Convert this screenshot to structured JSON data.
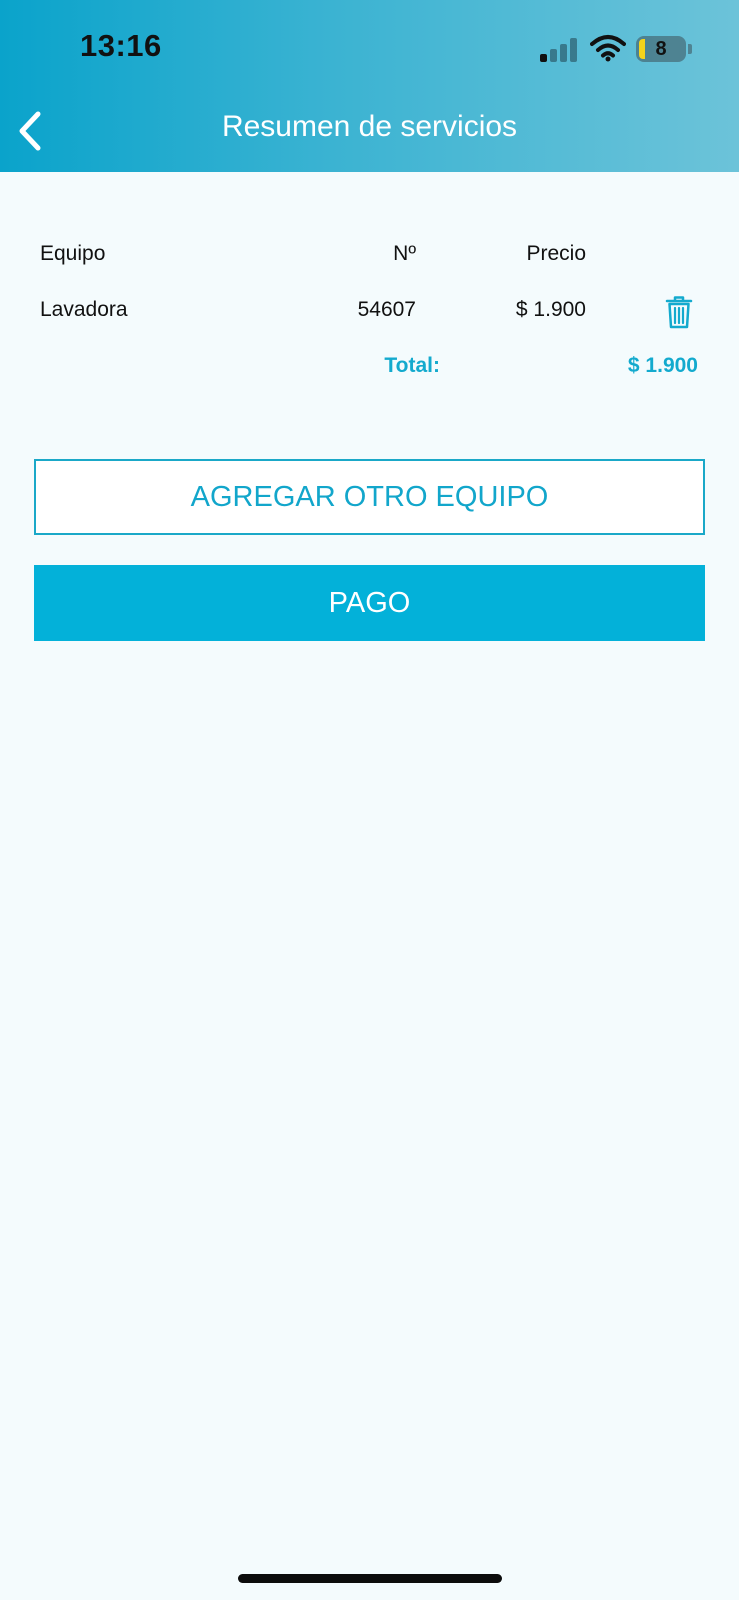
{
  "status_bar": {
    "time": "13:16",
    "battery": "8"
  },
  "header": {
    "title": "Resumen de servicios"
  },
  "table": {
    "columns": [
      "Equipo",
      "Nº",
      "Precio"
    ],
    "rows": [
      {
        "equipo": "Lavadora",
        "numero": "54607",
        "precio": "$ 1.900"
      }
    ],
    "total_label": "Total:",
    "total_value": "$ 1.900"
  },
  "buttons": {
    "add_label": "AGREGAR OTRO EQUIPO",
    "pay_label": "PAGO"
  },
  "icons": {
    "back": "chevron-left-icon",
    "delete": "trash-icon",
    "signal": "cellular-signal-icon",
    "wifi": "wifi-icon",
    "battery": "battery-icon"
  },
  "colors": {
    "accent": "#03b1d9",
    "header_start": "#0aa3cb",
    "header_end": "#6cc3d9",
    "background": "#f4fbfd"
  }
}
